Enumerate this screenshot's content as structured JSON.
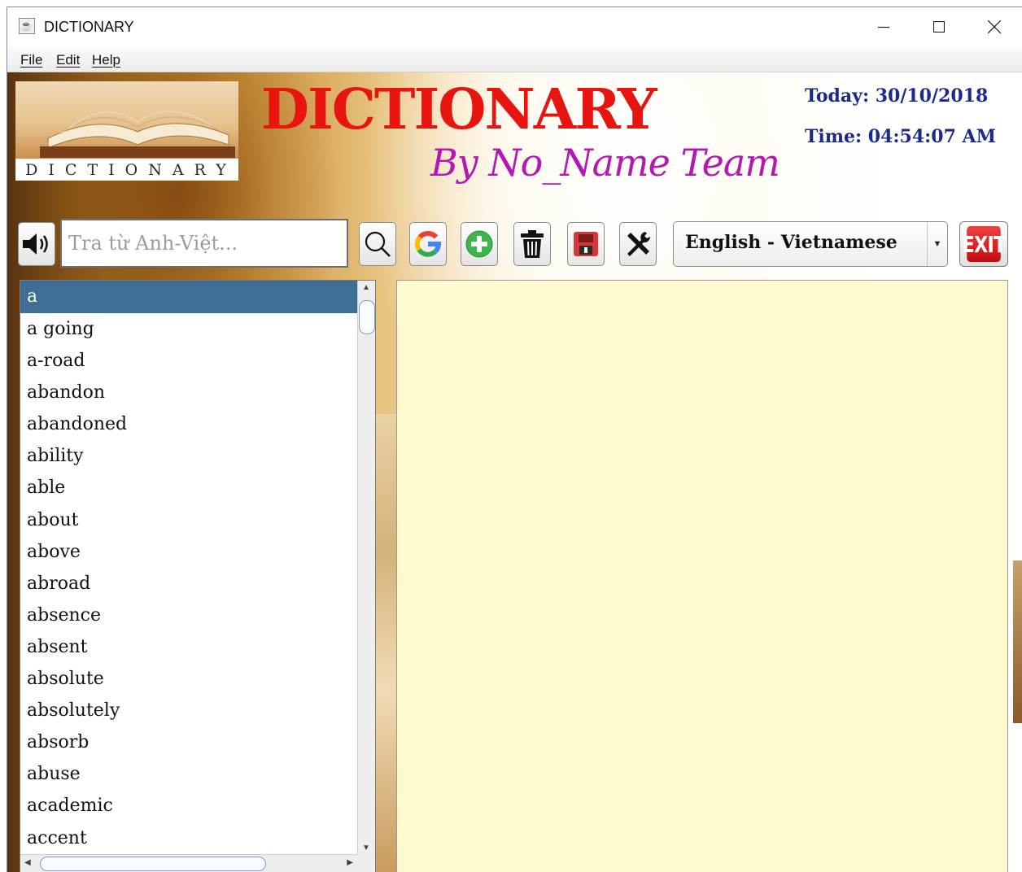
{
  "window": {
    "title": "DICTIONARY",
    "controls": {
      "minimize": "minimize",
      "maximize": "maximize",
      "close": "close"
    }
  },
  "menu": {
    "file": "File",
    "edit": "Edit",
    "help": "Help"
  },
  "header": {
    "logo_text": "DICTIONARY",
    "title": "DICTIONARY",
    "subtitle": "By No_Name Team",
    "today": "Today: 30/10/2018",
    "time": "Time: 04:54:07 AM"
  },
  "toolbar": {
    "search_placeholder": "Tra từ Anh-Việt...",
    "search_value": "",
    "language_selected": "English - Vietnamese",
    "exit_label": "EXIT",
    "icons": [
      "speaker-icon",
      "search-icon",
      "google-icon",
      "add-icon",
      "trash-icon",
      "save-icon",
      "tools-icon"
    ]
  },
  "word_list": {
    "selected_index": 0,
    "items": [
      "a",
      "a going",
      "a-road",
      "abandon",
      "abandoned",
      "ability",
      "able",
      "about",
      "above",
      "abroad",
      "absence",
      "absent",
      "absolute",
      "absolutely",
      "absorb",
      "abuse",
      "academic",
      "accent"
    ]
  },
  "meaning": {
    "text": ""
  },
  "colors": {
    "title_red": "#e8140f",
    "subtitle_magenta": "#b417b2",
    "datetime_blue": "#1c2a8a",
    "selection_blue": "#3f6e95",
    "meaning_bg": "#fffacd"
  }
}
